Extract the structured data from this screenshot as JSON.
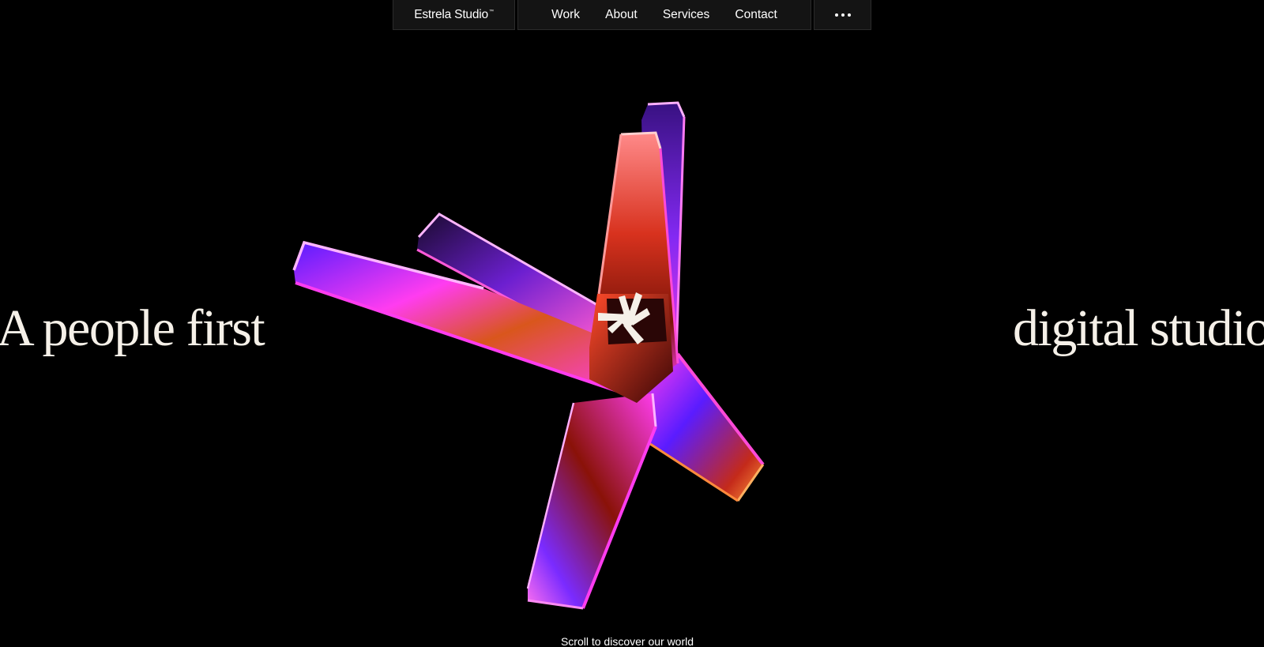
{
  "nav": {
    "brand": "Estrela Studio",
    "brand_mark": "™",
    "links": [
      "Work",
      "About",
      "Services",
      "Contact"
    ],
    "more_icon": "ellipsis-icon"
  },
  "hero": {
    "left_text": "A people first",
    "right_text": "digital studio",
    "artwork_icon": "iridescent-star-sculpture",
    "center_mark_icon": "star-logo-icon"
  },
  "scroll_hint": "Scroll to discover our world",
  "colors": {
    "background": "#000000",
    "nav_background": "#141414",
    "hero_text": "#f5f0e8",
    "accent_magenta": "#ff3cf0",
    "accent_orange": "#ff7a1a",
    "accent_violet": "#5a1cff"
  }
}
